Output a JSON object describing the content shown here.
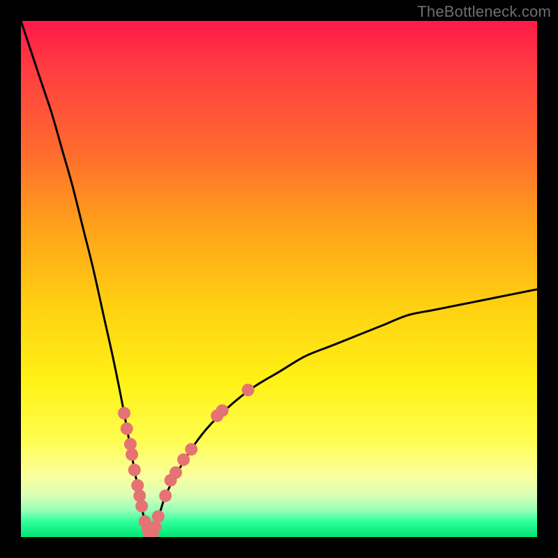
{
  "watermark": "TheBottleneck.com",
  "colors": {
    "frame": "#000000",
    "curve": "#000000",
    "marker_fill": "#e57373",
    "marker_stroke": "#d46a6a",
    "gradient_stops": [
      {
        "pos": 0.0,
        "hex": "#ff1a4a"
      },
      {
        "pos": 0.1,
        "hex": "#ff3f40"
      },
      {
        "pos": 0.25,
        "hex": "#ff6a2e"
      },
      {
        "pos": 0.4,
        "hex": "#ffa21a"
      },
      {
        "pos": 0.55,
        "hex": "#ffd012"
      },
      {
        "pos": 0.7,
        "hex": "#fff215"
      },
      {
        "pos": 0.81,
        "hex": "#fffd4f"
      },
      {
        "pos": 0.88,
        "hex": "#fbff9c"
      },
      {
        "pos": 0.92,
        "hex": "#d9ffb6"
      },
      {
        "pos": 0.95,
        "hex": "#8fffb7"
      },
      {
        "pos": 0.97,
        "hex": "#2fff9b"
      },
      {
        "pos": 1.0,
        "hex": "#00e574"
      }
    ]
  },
  "chart_data": {
    "type": "line",
    "title": "",
    "xlabel": "",
    "ylabel": "",
    "xlim": [
      0,
      100
    ],
    "ylim": [
      0,
      100
    ],
    "x_of_minimum": 25,
    "note": "V-shaped bottleneck curve. y is approximately |1 - x/25| * 100, clamped to [0,100]. Minimum (0) at x≈25. Left branch reaches y=100 at x=0. Right branch reaches y≈48 at x=100 (sublinear falloff on the right side).",
    "series": [
      {
        "name": "bottleneck-curve",
        "x": [
          0,
          2,
          4,
          6,
          8,
          10,
          12,
          14,
          16,
          18,
          20,
          22,
          23,
          24,
          25,
          26,
          27,
          28,
          30,
          33,
          36,
          40,
          45,
          50,
          55,
          60,
          65,
          70,
          75,
          80,
          85,
          90,
          95,
          100
        ],
        "y": [
          100,
          94,
          88,
          82,
          75,
          68,
          60,
          52,
          43,
          34,
          24,
          13,
          8,
          3,
          0,
          2,
          5,
          8,
          12,
          17,
          21,
          25,
          29,
          32,
          35,
          37,
          39,
          41,
          43,
          44,
          45,
          46,
          47,
          48
        ]
      }
    ],
    "markers": {
      "name": "highlighted-points",
      "desc": "Pink circular markers clustered near the valley on both branches (roughly between y=2 and y=28).",
      "points": [
        {
          "x": 20.0,
          "y": 24
        },
        {
          "x": 20.5,
          "y": 21
        },
        {
          "x": 21.2,
          "y": 18
        },
        {
          "x": 21.5,
          "y": 16
        },
        {
          "x": 22.0,
          "y": 13
        },
        {
          "x": 22.6,
          "y": 10
        },
        {
          "x": 23.0,
          "y": 8
        },
        {
          "x": 23.4,
          "y": 6
        },
        {
          "x": 24.0,
          "y": 3
        },
        {
          "x": 24.6,
          "y": 1.5
        },
        {
          "x": 25.0,
          "y": 0.5
        },
        {
          "x": 25.5,
          "y": 0.5
        },
        {
          "x": 26.0,
          "y": 2
        },
        {
          "x": 26.6,
          "y": 4
        },
        {
          "x": 28.0,
          "y": 8
        },
        {
          "x": 29.0,
          "y": 11
        },
        {
          "x": 30.0,
          "y": 12.5
        },
        {
          "x": 31.5,
          "y": 15
        },
        {
          "x": 33.0,
          "y": 17
        },
        {
          "x": 38.0,
          "y": 23.5
        },
        {
          "x": 39.0,
          "y": 24.5
        },
        {
          "x": 44.0,
          "y": 28.5
        }
      ],
      "radius_px": 9
    }
  }
}
